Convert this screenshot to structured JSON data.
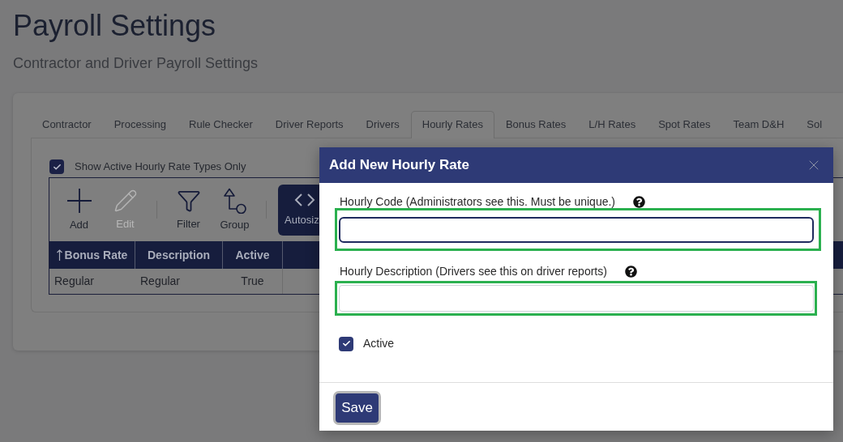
{
  "page": {
    "title": "Payroll Settings",
    "subtitle": "Contractor and Driver Payroll Settings"
  },
  "tabs": [
    {
      "label": "Contractor",
      "selected": false
    },
    {
      "label": "Processing",
      "selected": false
    },
    {
      "label": "Rule Checker",
      "selected": false
    },
    {
      "label": "Driver Reports",
      "selected": false
    },
    {
      "label": "Drivers",
      "selected": false
    },
    {
      "label": "Hourly Rates",
      "selected": true
    },
    {
      "label": "Bonus Rates",
      "selected": false
    },
    {
      "label": "L/H Rates",
      "selected": false
    },
    {
      "label": "Spot Rates",
      "selected": false
    },
    {
      "label": "Team D&H",
      "selected": false
    },
    {
      "label": "Sol",
      "selected": false
    }
  ],
  "filter": {
    "label": "Show Active Hourly Rate Types Only",
    "checked": true
  },
  "toolbar_groups": [
    {
      "items": [
        {
          "kind": "add",
          "label": "Add",
          "disabled": false
        },
        {
          "kind": "edit",
          "label": "Edit",
          "disabled": true
        }
      ]
    },
    {
      "items": [
        {
          "kind": "filter",
          "label": "Filter",
          "disabled": false
        },
        {
          "kind": "group",
          "label": "Group",
          "disabled": false
        }
      ]
    },
    {
      "items": [
        {
          "kind": "autosize",
          "label": "Autosiz",
          "disabled": false
        }
      ]
    }
  ],
  "table": {
    "columns": [
      {
        "label": "Bonus Rate",
        "sorted": true
      },
      {
        "label": "Description",
        "sorted": false
      },
      {
        "label": "Active",
        "sorted": false
      }
    ],
    "rows": [
      [
        "Regular",
        "Regular",
        "True"
      ]
    ]
  },
  "dialog": {
    "title": "Add New Hourly Rate",
    "fields": [
      {
        "label": "Hourly Code (Administrators see this. Must be unique.)",
        "focused": true,
        "highlighted": true
      },
      {
        "label": "Hourly Description (Drivers see this on driver reports)",
        "focused": false,
        "highlighted": true
      }
    ],
    "active": {
      "label": "Active",
      "checked": true
    },
    "save_button": "Save"
  }
}
